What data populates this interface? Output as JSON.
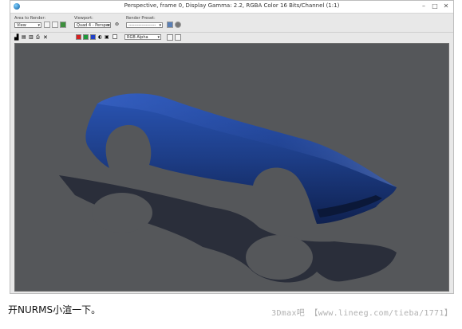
{
  "window": {
    "title": "Perspective, frame 0, Display Gamma: 2.2, RGBA Color 16 Bits/Channel (1:1)",
    "controls": {
      "minimize": "–",
      "maximize": "□",
      "close": "✕"
    }
  },
  "toolbar": {
    "area_label": "Area to Render:",
    "area_value": "View",
    "viewport_label": "Viewport:",
    "viewport_value": "Quad 4 - Perspec",
    "preset_label": "Render Preset:",
    "preset_value": "-------------------",
    "channel_value": "RGB Alpha"
  },
  "colors": {
    "car_body": "#1d3d86",
    "background": "#55575a",
    "shadow": "#2a2e3a",
    "red_channel": "#d62020",
    "green_channel": "#1d9a3a",
    "blue_channel": "#2040c8"
  },
  "caption": "开NURMS小渲一下。",
  "watermark": "3Dmax吧 【www.lineeg.com/tieba/1771】"
}
